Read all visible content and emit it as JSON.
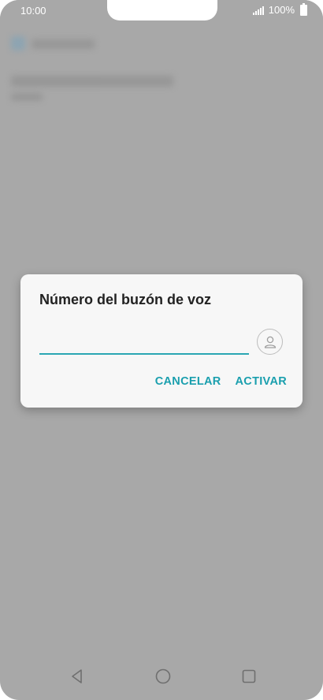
{
  "status_bar": {
    "time": "10:00",
    "battery_text": "100%",
    "icons": [
      "signal-icon",
      "battery-icon"
    ]
  },
  "dialog": {
    "title": "Número del buzón de voz",
    "input_value": "",
    "input_placeholder": "",
    "contact_icon": "contact-person-icon",
    "cancel_label": "CANCELAR",
    "activate_label": "ACTIVAR"
  },
  "nav_bar": {
    "icons": [
      "back-icon",
      "home-icon",
      "recents-icon"
    ]
  },
  "colors": {
    "accent": "#1a9fae",
    "input_underline": "#2aa6b3",
    "dialog_bg": "#f7f7f7",
    "scrim": "#a8a8a8"
  }
}
